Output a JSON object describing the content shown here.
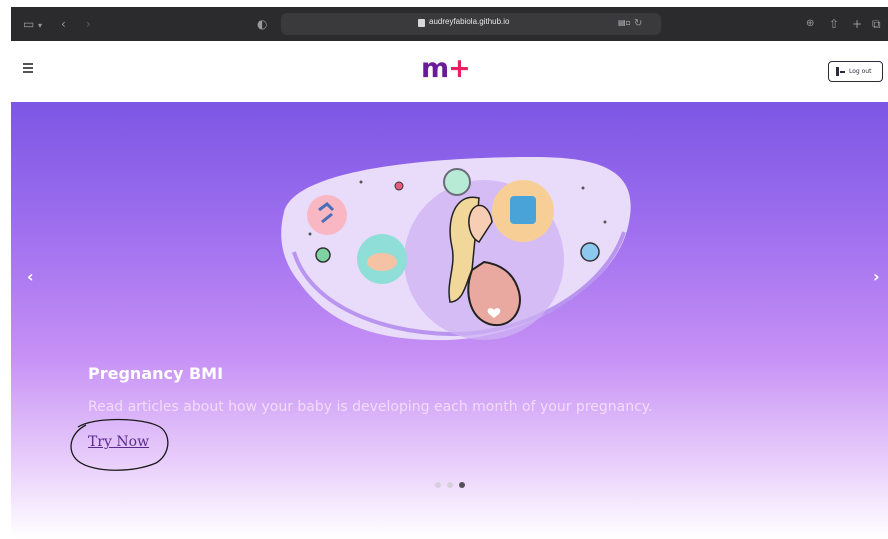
{
  "browser": {
    "url": "audreyfabiola.github.io",
    "icons": [
      "sidebar-icon",
      "chevron-down-icon",
      "back-icon",
      "forward-icon",
      "privacy-shield-icon",
      "lock-icon",
      "reader-icon",
      "reload-icon",
      "download-icon",
      "share-icon",
      "new-tab-icon",
      "tab-overview-icon"
    ]
  },
  "header": {
    "logo_text": "m",
    "logo_plus": "+",
    "logout_label": "Log out",
    "brand_color": "#6a1b9a",
    "accent_color": "#e91e63"
  },
  "carousel": {
    "prev_label": "‹",
    "next_label": "›",
    "active_slide": 3,
    "slide_count": 3,
    "slide": {
      "title": "Pregnancy BMI",
      "description": "Read articles about how your baby is developing each month of your pregnancy.",
      "cta_label": "Try Now"
    }
  },
  "colors": {
    "hero_top": "#7c56e4",
    "hero_bottom": "#e8cdfb"
  }
}
